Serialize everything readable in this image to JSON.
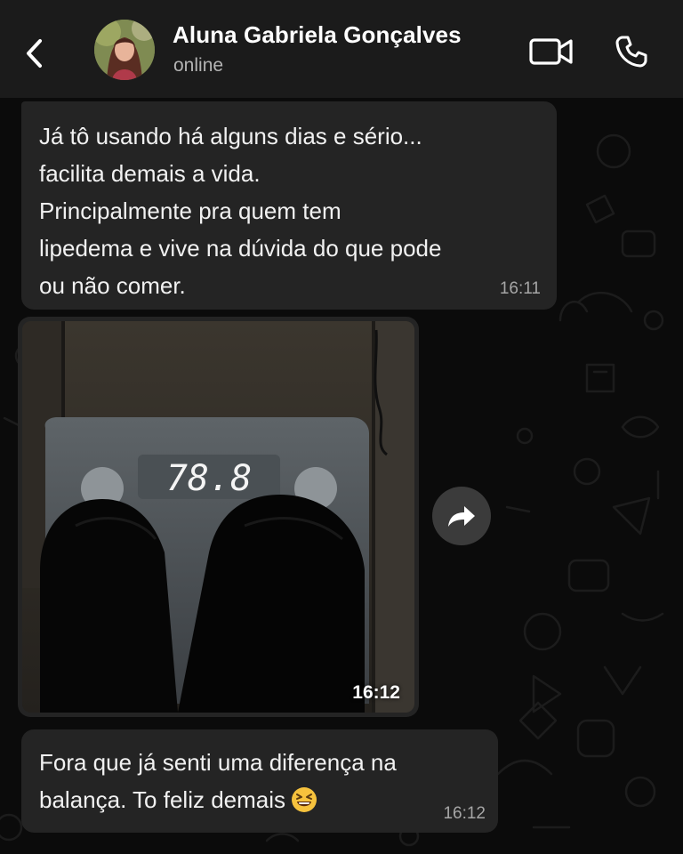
{
  "header": {
    "back_icon": "chevron-left-icon",
    "contact_name": "Aluna Gabriela Gonçalves",
    "status": "online",
    "video_icon": "video-camera-icon",
    "call_icon": "phone-icon"
  },
  "messages": [
    {
      "type": "text",
      "text": "Já tô usando há alguns dias e sério...\nfacilita demais a vida.\nPrincipalmente pra quem tem\nlipedema e vive na dúvida do que pode\nou não comer.",
      "time": "16:11"
    },
    {
      "type": "image",
      "scale_reading": "78.8",
      "time": "16:12",
      "forward_icon": "forward-arrow-icon"
    },
    {
      "type": "text",
      "text": "Fora que já senti uma diferença na\nbalança. To feliz demais",
      "emoji": "grinning-squinting-face-icon",
      "time": "16:12"
    }
  ],
  "colors": {
    "header_bg": "#1b1b1b",
    "chat_bg": "#0b0b0b",
    "bubble_bg": "#242424",
    "text": "#f1f1f1",
    "time": "#a6a6a6"
  }
}
